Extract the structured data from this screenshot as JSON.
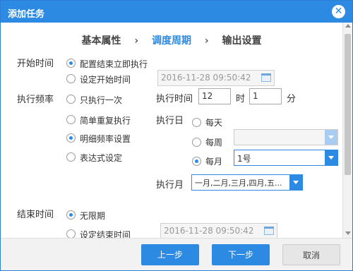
{
  "dialog": {
    "title": "添加任务",
    "close": "✕"
  },
  "steps": [
    "基本属性",
    "调度周期",
    "输出设置"
  ],
  "step_separator": "›",
  "start_time": {
    "label": "开始时间",
    "options": [
      "配置结束立即执行",
      "设定开始时间"
    ],
    "selected": 0,
    "datetime_value": "2016-11-28 09:50:42"
  },
  "frequency": {
    "label": "执行频率",
    "options": [
      "只执行一次",
      "简单重复执行",
      "明细频率设置",
      "表达式设定"
    ],
    "selected": 2,
    "exec_time_label": "执行时间",
    "hour": "12",
    "hour_unit": "时",
    "minute": "1",
    "minute_unit": "分",
    "exec_day_label": "执行日",
    "day_options": [
      "每天",
      "每周",
      "每月"
    ],
    "day_selected": 2,
    "week_select_value": "",
    "month_select_value": "1号",
    "exec_month_label": "执行月",
    "month_list_value": "一月,二月,三月,四月,五..."
  },
  "end_time": {
    "label": "结束时间",
    "options": [
      "无限期",
      "设定结束时间"
    ],
    "selected": 0,
    "datetime_value": "2016-11-28 09:50:42"
  },
  "footer": {
    "prev": "上一步",
    "next": "下一步",
    "cancel": "取消"
  },
  "colors": {
    "accent": "#2d8ae2"
  }
}
